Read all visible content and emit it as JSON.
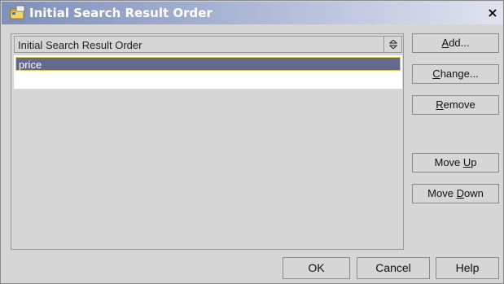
{
  "window": {
    "title": "Initial Search Result Order",
    "icon": "folder-app-icon",
    "close_label": "×"
  },
  "combo": {
    "selected": "Initial Search Result Order",
    "arrow_icon": "up-down-arrows-icon"
  },
  "list": {
    "items": [
      "price"
    ],
    "selected_index": 0
  },
  "side_buttons": {
    "add": {
      "before": "",
      "mnemonic": "A",
      "after": "dd..."
    },
    "change": {
      "before": "",
      "mnemonic": "C",
      "after": "hange..."
    },
    "remove": {
      "before": "",
      "mnemonic": "R",
      "after": "emove"
    },
    "move_up": {
      "before": "Move ",
      "mnemonic": "U",
      "after": "p"
    },
    "move_down": {
      "before": "Move ",
      "mnemonic": "D",
      "after": "own"
    }
  },
  "footer": {
    "ok": "OK",
    "cancel": "Cancel",
    "help": "Help"
  },
  "colors": {
    "title_gradient_start": "#7f8fb8",
    "title_gradient_end": "#dfe3ef",
    "selection_bg": "#636a8e",
    "selection_border": "#e0c94a",
    "dialog_bg": "#d6d6d6"
  }
}
